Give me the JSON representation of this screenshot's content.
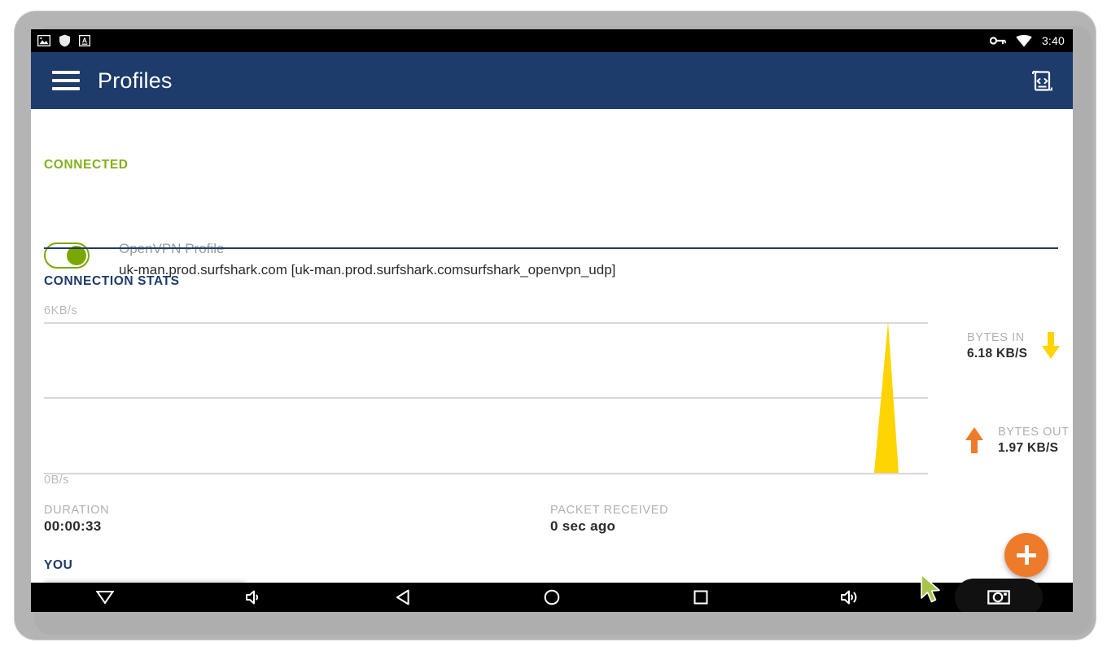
{
  "status_bar": {
    "icons": [
      "image-icon",
      "shield-icon",
      "font-icon"
    ],
    "right_icons": [
      "vpn-key-icon",
      "wifi-icon"
    ],
    "time": "3:40"
  },
  "app_bar": {
    "menu_icon": "hamburger-menu-icon",
    "title": "Profiles",
    "import_icon": "import-profile-file-icon"
  },
  "connected_section": {
    "header": "CONNECTED",
    "toggle_state": "on",
    "profile_type": "OpenVPN Profile",
    "profile_name": "uk-man.prod.surfshark.com [uk-man.prod.surfshark.comsurfshark_openvpn_udp]"
  },
  "stats_section": {
    "header": "CONNECTION STATS",
    "bytes_in": {
      "label": "BYTES IN",
      "value": "6.18 KB/S",
      "icon": "arrow-down-icon",
      "color": "#FFD400"
    },
    "bytes_out": {
      "label": "BYTES OUT",
      "value": "1.97 KB/S",
      "icon": "arrow-up-icon",
      "color": "#EE7B2A"
    },
    "duration": {
      "label": "DURATION",
      "value": "00:00:33"
    },
    "packet_received": {
      "label": "PACKET RECEIVED",
      "value": "0 sec ago"
    }
  },
  "chart_data": {
    "type": "area",
    "title": "",
    "xlabel": "",
    "ylabel": "",
    "top_tick": "6KB/s",
    "bottom_tick": "0B/s",
    "ylim": [
      0,
      6
    ],
    "ytick_values": [
      6,
      3,
      0
    ],
    "grid": true,
    "legend": "none",
    "series": [
      {
        "name": "Bytes In",
        "color": "#FFD400",
        "points": [
          {
            "x": 0,
            "y": 0
          },
          {
            "x": 0.94,
            "y": 0
          },
          {
            "x": 0.96,
            "y": 6.0
          },
          {
            "x": 0.985,
            "y": 0
          }
        ]
      }
    ]
  },
  "you_section": {
    "header": "YOU",
    "redacted_value": ""
  },
  "fab": {
    "icon": "plus-icon",
    "label": "Add profile",
    "color": "#EE7B2A"
  },
  "nav_bar": {
    "buttons": [
      {
        "name": "hide-keyboard",
        "icon": "chevron-down-icon"
      },
      {
        "name": "volume-down",
        "icon": "volume-down-icon"
      },
      {
        "name": "back",
        "icon": "back-triangle-icon"
      },
      {
        "name": "home",
        "icon": "home-circle-icon"
      },
      {
        "name": "recents",
        "icon": "square-icon"
      },
      {
        "name": "volume-up",
        "icon": "volume-up-icon"
      },
      {
        "name": "screenshot",
        "icon": "camera-icon"
      }
    ]
  },
  "colors": {
    "app_bar": "#1D3B6B",
    "accent_green": "#7BA800",
    "accent_orange": "#EE7B2A",
    "accent_yellow": "#FFD400",
    "navy_text": "#1D3B6B"
  }
}
